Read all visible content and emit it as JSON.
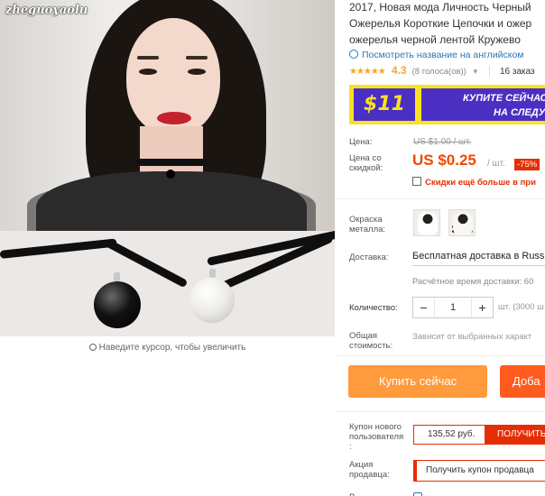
{
  "gallery": {
    "watermark": "zheguoyaolu",
    "hover_hint": "Наведите курсор, чтобы увеличить"
  },
  "product": {
    "title_lines": [
      "2017, Новая мода Личность Черный",
      "Ожерелья Короткие Цепочки и ожер",
      "ожерелья черной лентой Кружево"
    ],
    "translate_link": "Посмотреть название на английском",
    "rating_value": "4.3",
    "reviews": "(8 голоса(ов))",
    "orders": "16 заказ",
    "stars": "★★★★★"
  },
  "banner": {
    "price": "$11",
    "text_line1": "КУПИТЕ СЕЙЧАС",
    "text_line2": "НА СЛЕДУ"
  },
  "pricing": {
    "price_label": "Цена:",
    "old_price": "US $1.00 / шт.",
    "discount_label_line1": "Цена со",
    "discount_label_line2": "скидкой:",
    "current_price": "US $0.25",
    "unit": "/ шт.",
    "discount": "-75%",
    "coupon_note": "Скидки ещё больше в при"
  },
  "options": {
    "metal_label_line1": "Окраска",
    "metal_label_line2": "металла:",
    "shipping_label": "Доставка:",
    "shipping_value": "Бесплатная доставка в Russi",
    "shipping_time": "Расчётное время доставки: 60",
    "qty_label": "Количество:",
    "qty_value": "1",
    "qty_unit": "шт. (3000 ш",
    "total_label_line1": "Общая",
    "total_label_line2": "стоимость:",
    "total_value": "Зависит от выбранных характ"
  },
  "actions": {
    "buy_now": "Купить сейчас",
    "add_cart": "Доба"
  },
  "coupons": {
    "new_user_label_line1": "Купон нового",
    "new_user_label_line2": "пользователя",
    "new_user_label_line3": ":",
    "new_user_amount": "135,52 руб.",
    "new_user_button": "ПОЛУЧИТЬ",
    "seller_label_line1": "Акция",
    "seller_label_line2": "продавца:",
    "seller_button": "Получить купон продавца",
    "bottom_label": "В"
  },
  "colors": {
    "accent_orange": "#f04a00",
    "buy_button": "#ff9a3d",
    "cart_button": "#ff5a1f",
    "red": "#e62e04",
    "link_blue": "#2a75b8",
    "banner_yellow": "#f9e11f",
    "banner_purple": "#4a2fc2"
  }
}
